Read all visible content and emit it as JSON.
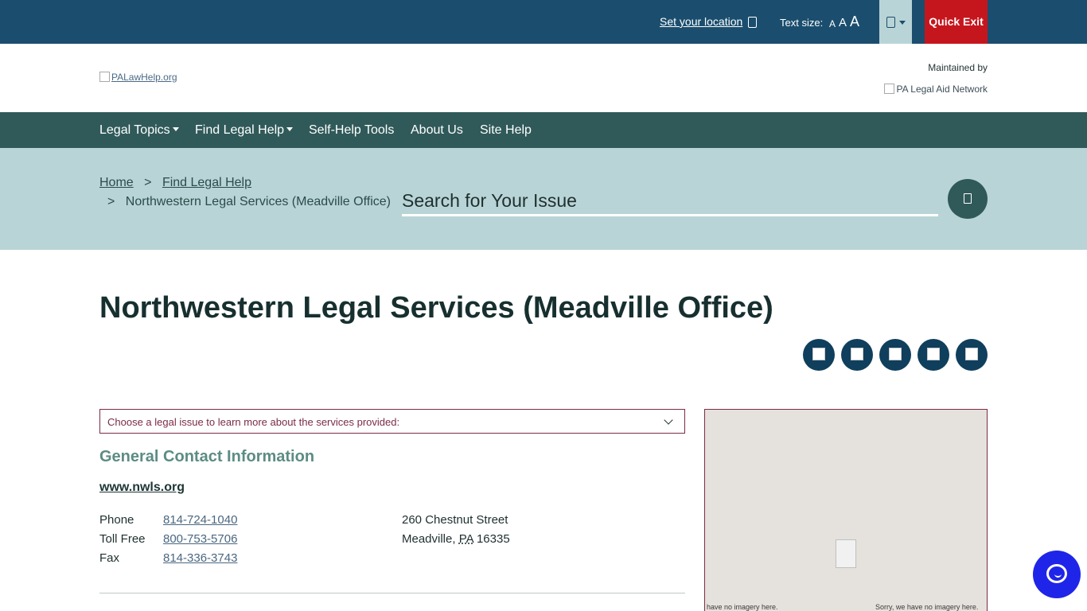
{
  "topbar": {
    "location_label": "Set your location",
    "location_icon": "map-pin-icon",
    "text_size_label": "Text size:",
    "text_size_options": [
      "A",
      "A",
      "A"
    ],
    "language_icon": "globe-icon",
    "quick_exit_label": "Quick Exit",
    "colors": {
      "bar": "#1b4e6e",
      "quick_exit": "#c6161d",
      "language_button": "#b9d4d6"
    }
  },
  "header": {
    "logo_alt": "PALawHelp.org",
    "maintained_by": "Maintained by",
    "partner_alt": "PA Legal Aid Network"
  },
  "nav": {
    "items": [
      {
        "label": "Legal Topics",
        "dropdown": true
      },
      {
        "label": "Find Legal Help",
        "dropdown": true
      },
      {
        "label": "Self-Help Tools",
        "dropdown": false
      },
      {
        "label": "About Us",
        "dropdown": false
      },
      {
        "label": "Site Help",
        "dropdown": false
      }
    ],
    "color": "#305a59"
  },
  "breadcrumb": {
    "home": "Home",
    "separator": ">",
    "parent": "Find Legal Help",
    "current": "Northwestern Legal Services (Meadville Office)"
  },
  "search": {
    "placeholder": "Search for Your Issue",
    "button_icon": "search-icon"
  },
  "page": {
    "title": "Northwestern Legal Services (Meadville Office)",
    "share_icons": [
      "share-icon-1",
      "share-icon-2",
      "share-icon-3",
      "share-icon-4",
      "share-icon-5"
    ]
  },
  "issue_select": {
    "selected": "Choose a legal issue to learn more about the services provided:"
  },
  "contact": {
    "heading": "General Contact Information",
    "website": "www.nwls.org",
    "phones": [
      {
        "label": "Phone",
        "value": "814-724-1040"
      },
      {
        "label": "Toll Free",
        "value": "800-753-5706"
      },
      {
        "label": "Fax",
        "value": "814-336-3743"
      }
    ],
    "address": {
      "street": "260 Chestnut Street",
      "city": "Meadville,",
      "state": "PA",
      "zip": "16335"
    }
  },
  "map": {
    "message_left": "have no imagery here.",
    "message_right": "Sorry, we have no imagery here."
  },
  "chat": {
    "icon": "chat-icon",
    "color": "#1f25e8"
  }
}
